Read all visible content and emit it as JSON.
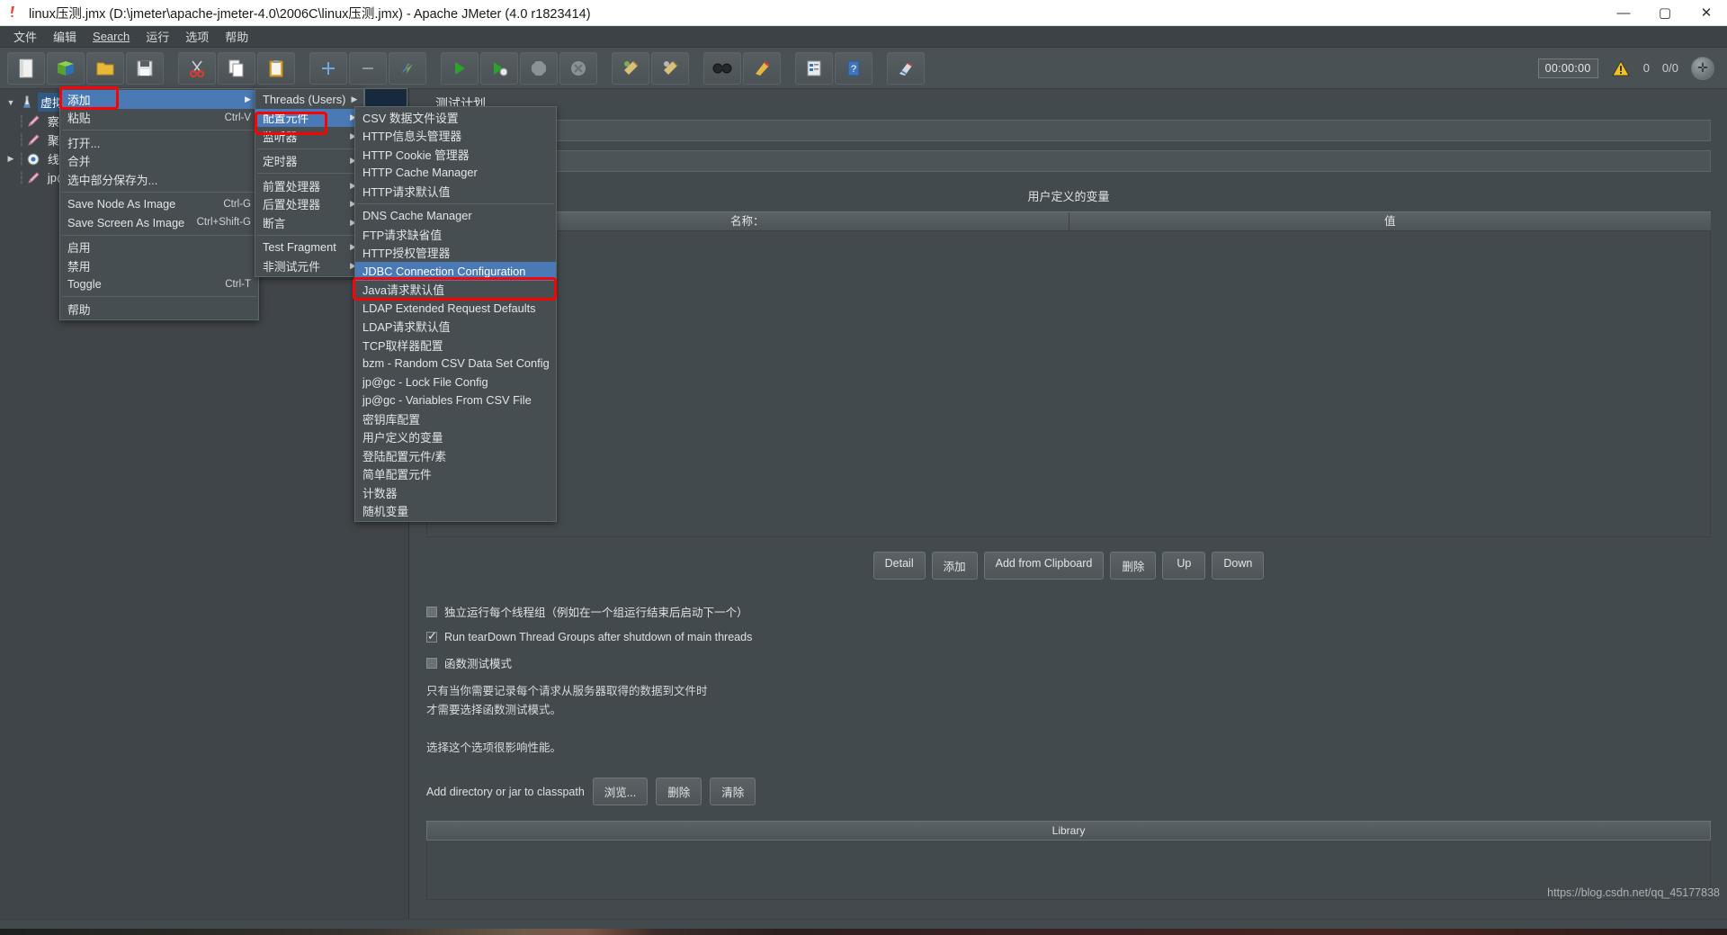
{
  "window": {
    "title": "linux压测.jmx (D:\\jmeter\\apache-jmeter-4.0\\2006C\\linux压测.jmx) - Apache JMeter (4.0 r1823414)",
    "minimize": "—",
    "maximize": "▢",
    "close": "✕",
    "app_icon": "jmeter-icon"
  },
  "menubar": [
    {
      "label": "文件"
    },
    {
      "label": "编辑"
    },
    {
      "label": "Search"
    },
    {
      "label": "运行"
    },
    {
      "label": "选项"
    },
    {
      "label": "帮助"
    }
  ],
  "toolbar": {
    "buttons": [
      {
        "name": "new-test-plan",
        "glyph": "📄"
      },
      {
        "name": "templates",
        "glyph": "📗"
      },
      {
        "name": "open",
        "glyph": "📂"
      },
      {
        "name": "save",
        "glyph": "💾"
      },
      {
        "name": "cut",
        "glyph": "✂"
      },
      {
        "name": "copy",
        "glyph": "📋"
      },
      {
        "name": "paste",
        "glyph": "📌"
      },
      {
        "name": "expand-all",
        "glyph": "＋"
      },
      {
        "name": "collapse-all",
        "glyph": "－"
      },
      {
        "name": "toggle",
        "glyph": "⚡"
      },
      {
        "name": "start",
        "glyph": "▶"
      },
      {
        "name": "start-no-pauses",
        "glyph": "▶"
      },
      {
        "name": "stop",
        "glyph": "⬭"
      },
      {
        "name": "shutdown",
        "glyph": "✖"
      },
      {
        "name": "clear",
        "glyph": "🧹"
      },
      {
        "name": "clear-all",
        "glyph": "🧹"
      },
      {
        "name": "search",
        "glyph": "🔭"
      },
      {
        "name": "reset-search",
        "glyph": "🔖"
      },
      {
        "name": "function-helper",
        "glyph": "🗒"
      },
      {
        "name": "help",
        "glyph": "❓"
      },
      {
        "name": "undo-redo",
        "glyph": "🎨"
      }
    ],
    "timer": "00:00:00",
    "warning_count": "0",
    "thread_count": "0/0",
    "sphere_icon": "globe-icon"
  },
  "tree": {
    "nodes": [
      {
        "label": "虚拟",
        "selected": true,
        "expanded": true,
        "depth": 0,
        "icon": "test-plan-icon",
        "twisty": "▼"
      },
      {
        "label": "察看",
        "selected": false,
        "depth": 1,
        "icon": "listener-icon",
        "twisty": ""
      },
      {
        "label": "聚合",
        "selected": false,
        "depth": 1,
        "icon": "listener-icon",
        "twisty": ""
      },
      {
        "label": "线程",
        "selected": false,
        "depth": 1,
        "icon": "thread-group-icon",
        "twisty": "▶"
      },
      {
        "label": "jp@",
        "selected": false,
        "depth": 1,
        "icon": "listener-icon",
        "twisty": ""
      }
    ]
  },
  "main": {
    "panel_title": "测试计划",
    "udv_title": "用户定义的变量",
    "columns": [
      "名称：",
      "值"
    ],
    "table_rows": [],
    "buttons": [
      {
        "label": "Detail"
      },
      {
        "label": "添加"
      },
      {
        "label": "Add from Clipboard"
      },
      {
        "label": "删除"
      },
      {
        "label": "Up"
      },
      {
        "label": "Down"
      }
    ],
    "checkboxes": [
      {
        "label": "独立运行每个线程组（例如在一个组运行结束后启动下一个）",
        "checked": false
      },
      {
        "label": "Run tearDown Thread Groups after shutdown of main threads",
        "checked": true
      },
      {
        "label": "函数测试模式",
        "checked": false
      }
    ],
    "help_lines": [
      "只有当你需要记录每个请求从服务器取得的数据到文件时",
      "才需要选择函数测试模式。",
      "",
      "选择这个选项很影响性能。"
    ],
    "classpath_label": "Add directory or jar to classpath",
    "classpath_buttons": [
      {
        "label": "浏览..."
      },
      {
        "label": "删除"
      },
      {
        "label": "清除"
      }
    ],
    "library_header": "Library",
    "watermark": "https://blog.csdn.net/qq_45177838"
  },
  "context_menu": {
    "items": [
      {
        "label": "添加",
        "accel": "",
        "arrow": "▶",
        "highlight": true
      },
      {
        "label": "粘贴",
        "accel": "Ctrl-V",
        "arrow": ""
      },
      {
        "sep": true
      },
      {
        "label": "打开...",
        "accel": "",
        "arrow": ""
      },
      {
        "label": "合并",
        "accel": "",
        "arrow": ""
      },
      {
        "label": "选中部分保存为...",
        "accel": "",
        "arrow": ""
      },
      {
        "sep": true
      },
      {
        "label": "Save Node As Image",
        "accel": "Ctrl-G",
        "arrow": ""
      },
      {
        "label": "Save Screen As Image",
        "accel": "Ctrl+Shift-G",
        "arrow": ""
      },
      {
        "sep": true
      },
      {
        "label": "启用",
        "accel": "",
        "arrow": ""
      },
      {
        "label": "禁用",
        "accel": "",
        "arrow": ""
      },
      {
        "label": "Toggle",
        "accel": "Ctrl-T",
        "arrow": ""
      },
      {
        "sep": true
      },
      {
        "label": "帮助",
        "accel": "",
        "arrow": ""
      }
    ]
  },
  "add_submenu": {
    "items": [
      {
        "label": "Threads (Users)",
        "arrow": "▶"
      },
      {
        "label": "配置元件",
        "arrow": "▶",
        "highlight": true
      },
      {
        "label": "监听器",
        "arrow": "▶"
      },
      {
        "sep": true
      },
      {
        "label": "定时器",
        "arrow": "▶"
      },
      {
        "sep": true
      },
      {
        "label": "前置处理器",
        "arrow": "▶"
      },
      {
        "label": "后置处理器",
        "arrow": "▶"
      },
      {
        "label": "断言",
        "arrow": "▶"
      },
      {
        "sep": true
      },
      {
        "label": "Test Fragment",
        "arrow": "▶"
      },
      {
        "label": "非测试元件",
        "arrow": "▶"
      }
    ]
  },
  "config_submenu": {
    "items": [
      {
        "label": "CSV 数据文件设置"
      },
      {
        "label": "HTTP信息头管理器"
      },
      {
        "label": "HTTP Cookie 管理器"
      },
      {
        "label": "HTTP Cache Manager"
      },
      {
        "label": "HTTP请求默认值"
      },
      {
        "sep": true
      },
      {
        "label": "DNS Cache Manager"
      },
      {
        "label": "FTP请求缺省值"
      },
      {
        "label": "HTTP授权管理器"
      },
      {
        "label": "JDBC Connection Configuration",
        "highlight": true
      },
      {
        "label": "Java请求默认值"
      },
      {
        "label": "LDAP Extended Request Defaults"
      },
      {
        "label": "LDAP请求默认值"
      },
      {
        "label": "TCP取样器配置"
      },
      {
        "label": "bzm - Random CSV Data Set Config"
      },
      {
        "label": "jp@gc - Lock File Config"
      },
      {
        "label": "jp@gc - Variables From CSV File"
      },
      {
        "label": "密钥库配置"
      },
      {
        "label": "用户定义的变量"
      },
      {
        "label": "登陆配置元件/素"
      },
      {
        "label": "简单配置元件"
      },
      {
        "label": "计数器"
      },
      {
        "label": "随机变量"
      }
    ]
  }
}
